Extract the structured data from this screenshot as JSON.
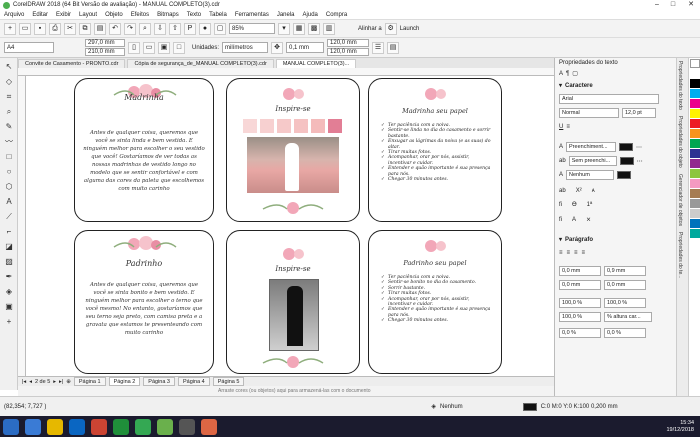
{
  "window": {
    "title": "CorelDRAW 2018 (64 Bit Versão de avaliação) - MANUAL COMPLETO(3).cdr",
    "min": "–",
    "max": "□",
    "close": "✕"
  },
  "menu": [
    "Arquivo",
    "Editar",
    "Exibir",
    "Layout",
    "Objeto",
    "Efeitos",
    "Bitmaps",
    "Texto",
    "Tabela",
    "Ferramentas",
    "Janela",
    "Ajuda",
    "Compra"
  ],
  "toolbar1": {
    "zoom": "85%",
    "snap": "Alinhar a",
    "launch": "Launch"
  },
  "toolbar2": {
    "page_size": "A4",
    "width": "297,0 mm",
    "height": "210,0 mm",
    "units_label": "Unidades:",
    "units": "milímetros",
    "nudge": "0,1 mm",
    "dup_x": "120,0 mm",
    "dup_y": "120,0 mm"
  },
  "doc_tabs": [
    "Convite de Casamento - PRONTO.cdr",
    "Cópia de segurança_de_MANUAL COMPLETO(3).cdr",
    "MANUAL COMPLETO(3)..."
  ],
  "cards": {
    "c1": {
      "title": "Madrinha",
      "body": "Antes de qualquer coisa, queremos que você se sinta linda e bem vestida. E ninguém melhor para escolher o seu vestido que você! Gostaríamos de ver todas as nossas madrinhas de vestido longo no modelo que se sentir confortável e com alguma das cores da paleta que escolhemos com muito carinho"
    },
    "c2": {
      "title": "Inspire-se"
    },
    "c3": {
      "title": "Madrinha seu papel",
      "items": [
        "Ter paciência com a noiva.",
        "Sentir-se linda no dia do casamento e sorrir bastante.",
        "Enxugar as lágrimas da noiva (e as suas) do altar.",
        "Tirar muitas fotos.",
        "Acompanhar, orar por nós, assistir, incentivar e cuidar.",
        "Entender e quão importante é sua presença para nós.",
        "Chegar 30 minutos antes."
      ]
    },
    "c4": {
      "title": "Padrinho",
      "body": "Antes de qualquer coisa, queremos que você se sinta bonito e bem vestido. E ninguém melhor para escolher o terno que você mesmo! No entanto, gostaríamos que seu terno seja preto, com camisa preta e a gravata que estamos te presenteando com muito carinho"
    },
    "c5": {
      "title": "Inspire-se"
    },
    "c6": {
      "title": "Padrinho seu papel",
      "items": [
        "Ter paciência com a noiva.",
        "Sentir-se bonito no dia do casamento.",
        "Sorrir bastante.",
        "Tirar muitas fotos.",
        "Acompanhar, orar por nós, assistir, incentivar e cuidar.",
        "Entender e quão importante é sua presença para nós.",
        "Chegar 30 minutos antes."
      ]
    }
  },
  "pages": {
    "counter": "2 de 5",
    "tabs": [
      "Página 1",
      "Página 2",
      "Página 3",
      "Página 4",
      "Página 5"
    ]
  },
  "hint": "Arraste cores (ou objetos) aqui para armazená-las com o documento",
  "status": {
    "coords": "(82,354; 7,727 )",
    "fill_label": "Nenhum",
    "color_info": "C:0 M:0 Y:0 K:100  0,200 mm"
  },
  "panel": {
    "title": "Propriedades do texto",
    "section_char": "Caractere",
    "font": "Arial",
    "style": "Normal",
    "size": "12,0 pt",
    "fill1": "Preenchiment...",
    "fill2": "Sem preenchi...",
    "outline": "Nenhum",
    "section_para": "Parágrafo",
    "indent1": "0,0 mm",
    "indent2": "0,9 mm",
    "indent3": "0,0 mm",
    "indent4": "0,0 mm",
    "spacing1": "100,0 %",
    "spacing2": "100,0 %",
    "spacing3": "100,0 %",
    "spacing4": "% altura car...",
    "spacing5": "0,0 %",
    "spacing6": "0,0 %"
  },
  "vtabs": [
    "Propriedades do texto",
    "Propriedades do objeto",
    "Gerenciador de objetos",
    "Propriedades do te..."
  ],
  "clock": {
    "time": "15:34",
    "date": "19/12/2018"
  },
  "colors": {
    "accent": "#2b6cc4",
    "pink": "#f3b7b7",
    "taskbar": "#1b1b2e"
  }
}
